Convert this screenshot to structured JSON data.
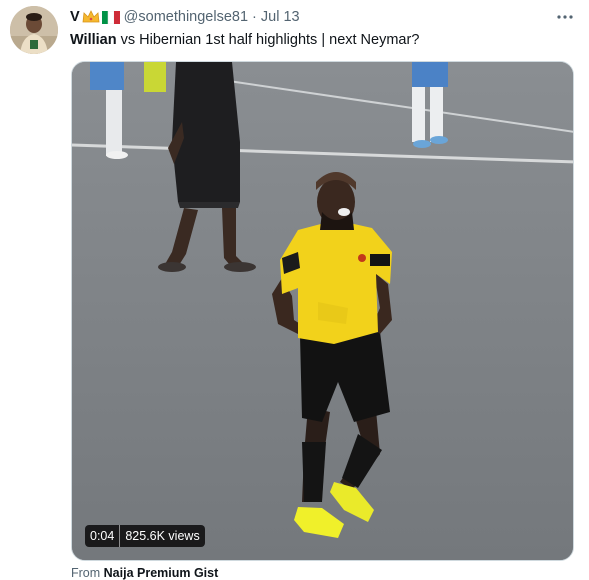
{
  "tweet": {
    "display_name": "V",
    "emojis": [
      "crown-emoji",
      "italy-flag-emoji"
    ],
    "handle": "@somethingelse81",
    "separator": "·",
    "date": "Jul 13",
    "text_bold": "Willian",
    "text_rest": " vs Hibernian 1st half highlights | next Neymar?",
    "more_icon": "more-horizontal-icon"
  },
  "video": {
    "time": "0:04",
    "views": "825.6K views"
  },
  "source": {
    "prefix": "From ",
    "name": "Naija Premium Gist"
  },
  "colors": {
    "handle": "#536471",
    "text": "#0f1419",
    "jersey": "#f2d21b"
  }
}
